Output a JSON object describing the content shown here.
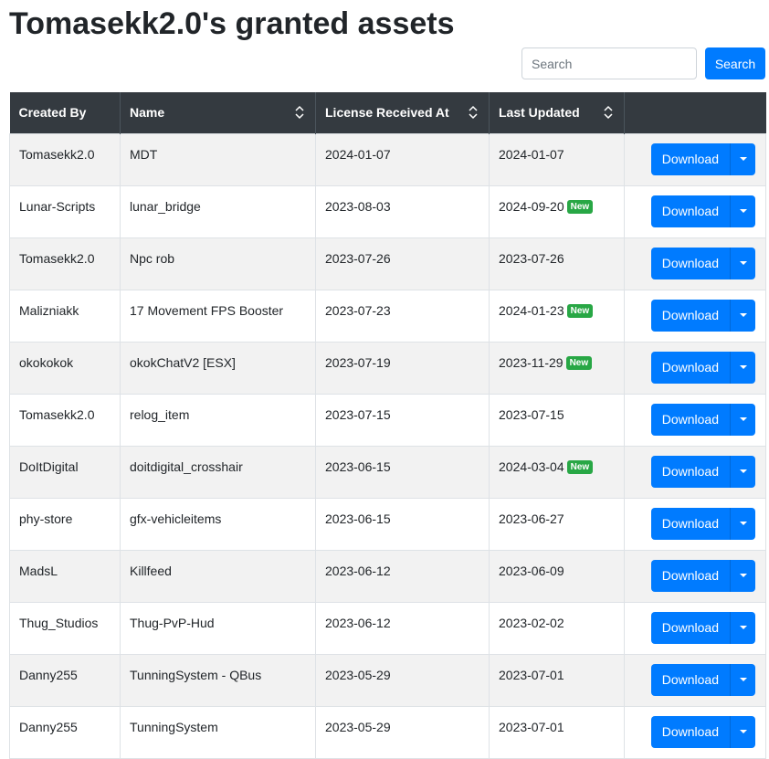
{
  "page": {
    "title": "Tomasekk2.0's granted assets"
  },
  "search": {
    "placeholder": "Search",
    "button_label": "Search"
  },
  "table": {
    "headers": [
      "Created By",
      "Name",
      "License Received At",
      "Last Updated",
      ""
    ],
    "download_label": "Download",
    "new_badge_label": "New",
    "rows": [
      {
        "created_by": "Tomasekk2.0",
        "name": "MDT",
        "license_received_at": "2024-01-07",
        "last_updated": "2024-01-07",
        "is_new": false
      },
      {
        "created_by": "Lunar-Scripts",
        "name": "lunar_bridge",
        "license_received_at": "2023-08-03",
        "last_updated": "2024-09-20",
        "is_new": true
      },
      {
        "created_by": "Tomasekk2.0",
        "name": "Npc rob",
        "license_received_at": "2023-07-26",
        "last_updated": "2023-07-26",
        "is_new": false
      },
      {
        "created_by": "Malizniakk",
        "name": "17 Movement FPS Booster",
        "license_received_at": "2023-07-23",
        "last_updated": "2024-01-23",
        "is_new": true
      },
      {
        "created_by": "okokokok",
        "name": "okokChatV2 [ESX]",
        "license_received_at": "2023-07-19",
        "last_updated": "2023-11-29",
        "is_new": true
      },
      {
        "created_by": "Tomasekk2.0",
        "name": "relog_item",
        "license_received_at": "2023-07-15",
        "last_updated": "2023-07-15",
        "is_new": false
      },
      {
        "created_by": "DoItDigital",
        "name": "doitdigital_crosshair",
        "license_received_at": "2023-06-15",
        "last_updated": "2024-03-04",
        "is_new": true
      },
      {
        "created_by": "phy-store",
        "name": "gfx-vehicleitems",
        "license_received_at": "2023-06-15",
        "last_updated": "2023-06-27",
        "is_new": false
      },
      {
        "created_by": "MadsL",
        "name": "Killfeed",
        "license_received_at": "2023-06-12",
        "last_updated": "2023-06-09",
        "is_new": false
      },
      {
        "created_by": "Thug_Studios",
        "name": "Thug-PvP-Hud",
        "license_received_at": "2023-06-12",
        "last_updated": "2023-02-02",
        "is_new": false
      },
      {
        "created_by": "Danny255",
        "name": "TunningSystem - QBus",
        "license_received_at": "2023-05-29",
        "last_updated": "2023-07-01",
        "is_new": false
      },
      {
        "created_by": "Danny255",
        "name": "TunningSystem",
        "license_received_at": "2023-05-29",
        "last_updated": "2023-07-01",
        "is_new": false
      }
    ]
  },
  "icons": {
    "sort": "sort-icon",
    "caret": "chevron-down-icon"
  },
  "colors": {
    "primary": "#007bff",
    "header_bg": "#343a40",
    "new_badge": "#28a745",
    "stripe": "#f2f2f2"
  }
}
